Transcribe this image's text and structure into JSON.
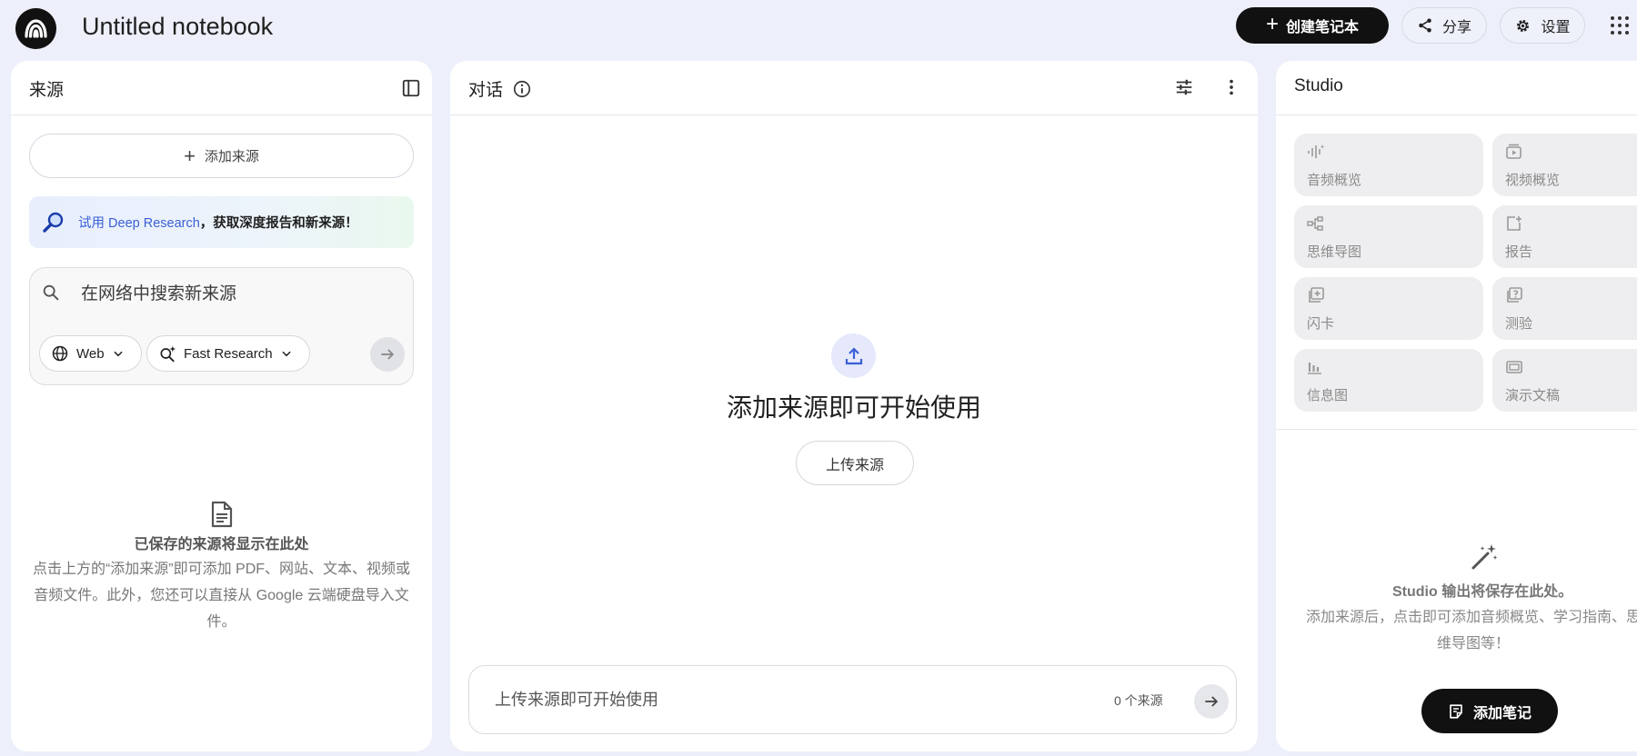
{
  "header": {
    "notebook_title": "Untitled notebook",
    "create_notebook_label": "创建笔记本",
    "share_label": "分享",
    "settings_label": "设置"
  },
  "sources": {
    "title": "来源",
    "add_source_label": "添加来源",
    "deep_research_link": "试用 Deep Research",
    "deep_research_rest": "，获取深度报告和新来源！",
    "search_placeholder": "在网络中搜索新来源",
    "web_chip_label": "Web",
    "fast_research_label": "Fast Research",
    "empty_title": "已保存的来源将显示在此处",
    "empty_desc": "点击上方的“添加来源”即可添加 PDF、网站、文本、视频或音频文件。此外，您还可以直接从 Google 云端硬盘导入文件。"
  },
  "chat": {
    "title": "对话",
    "headline": "添加来源即可开始使用",
    "upload_label": "上传来源",
    "input_placeholder": "上传来源即可开始使用",
    "source_count": "0 个来源"
  },
  "studio": {
    "title": "Studio",
    "tiles": [
      {
        "label": "音频概览",
        "icon": "audio-wave-icon"
      },
      {
        "label": "视频概览",
        "icon": "video-icon"
      },
      {
        "label": "思维导图",
        "icon": "mind-map-icon"
      },
      {
        "label": "报告",
        "icon": "report-icon"
      },
      {
        "label": "闪卡",
        "icon": "flashcard-icon"
      },
      {
        "label": "测验",
        "icon": "quiz-icon"
      },
      {
        "label": "信息图",
        "icon": "infographic-icon"
      },
      {
        "label": "演示文稿",
        "icon": "slides-icon"
      }
    ],
    "empty_title": "Studio 输出将保存在此处。",
    "empty_desc": "添加来源后，点击即可添加音频概览、学习指南、思维导图等！",
    "add_note_label": "添加笔记"
  },
  "colors": {
    "background": "#edeffa",
    "panel": "#ffffff",
    "primary_button": "#111111",
    "accent_link": "#3b5fd6",
    "upload_icon": "#3b5fd6"
  }
}
